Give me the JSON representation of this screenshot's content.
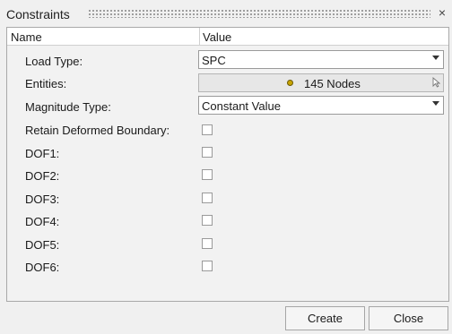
{
  "window": {
    "title": "Constraints",
    "close_glyph": "×"
  },
  "table": {
    "name_header": "Name",
    "value_header": "Value"
  },
  "fields": {
    "load_type": {
      "label": "Load Type:",
      "value": "SPC"
    },
    "entities": {
      "label": "Entities:",
      "value": "145 Nodes",
      "icon": "node-marker-icon"
    },
    "magnitude_type": {
      "label": "Magnitude Type:",
      "value": "Constant Value"
    },
    "retain": {
      "label": "Retain Deformed Boundary:",
      "checked": false
    },
    "dof1": {
      "label": "DOF1:",
      "checked": false
    },
    "dof2": {
      "label": "DOF2:",
      "checked": false
    },
    "dof3": {
      "label": "DOF3:",
      "checked": false
    },
    "dof4": {
      "label": "DOF4:",
      "checked": false
    },
    "dof5": {
      "label": "DOF5:",
      "checked": false
    },
    "dof6": {
      "label": "DOF6:",
      "checked": false
    }
  },
  "buttons": {
    "create": "Create",
    "close": "Close"
  }
}
